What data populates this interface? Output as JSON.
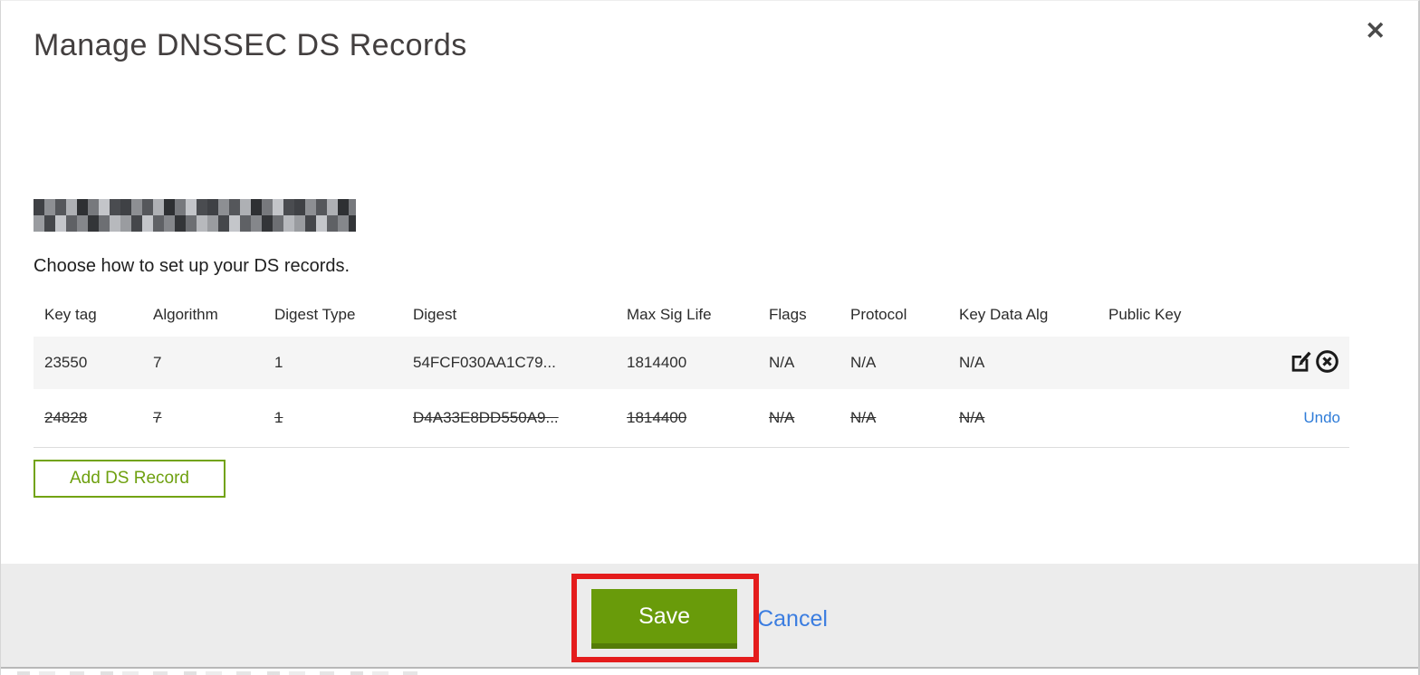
{
  "modal": {
    "title": "Manage DNSSEC DS Records",
    "close_glyph": "✕",
    "instruction": "Choose how to set up your DS records.",
    "table": {
      "columns": [
        "Key tag",
        "Algorithm",
        "Digest Type",
        "Digest",
        "Max Sig Life",
        "Flags",
        "Protocol",
        "Key Data Alg",
        "Public Key"
      ],
      "rows": [
        {
          "key_tag": "23550",
          "algorithm": "7",
          "digest_type": "1",
          "digest": "54FCF030AA1C79...",
          "max_sig_life": "1814400",
          "flags": "N/A",
          "protocol": "N/A",
          "key_data_alg": "N/A",
          "public_key": "",
          "state": "normal",
          "actions": [
            "edit",
            "delete"
          ]
        },
        {
          "key_tag": "24828",
          "algorithm": "7",
          "digest_type": "1",
          "digest": "D4A33E8DD550A9...",
          "max_sig_life": "1814400",
          "flags": "N/A",
          "protocol": "N/A",
          "key_data_alg": "N/A",
          "public_key": "",
          "state": "deleted",
          "undo_label": "Undo"
        }
      ]
    },
    "add_button_label": "Add DS Record",
    "footer": {
      "save_label": "Save",
      "cancel_label": "Cancel"
    }
  },
  "colors": {
    "accent_green": "#699b0a",
    "accent_green_dark": "#547c08",
    "outline_green": "#72a312",
    "link_blue": "#3b7de0",
    "undo_blue": "#2f7cd8",
    "annotation_red": "#e41c1c",
    "row_alt_bg": "#f5f5f5",
    "footer_bg": "#ececec"
  }
}
